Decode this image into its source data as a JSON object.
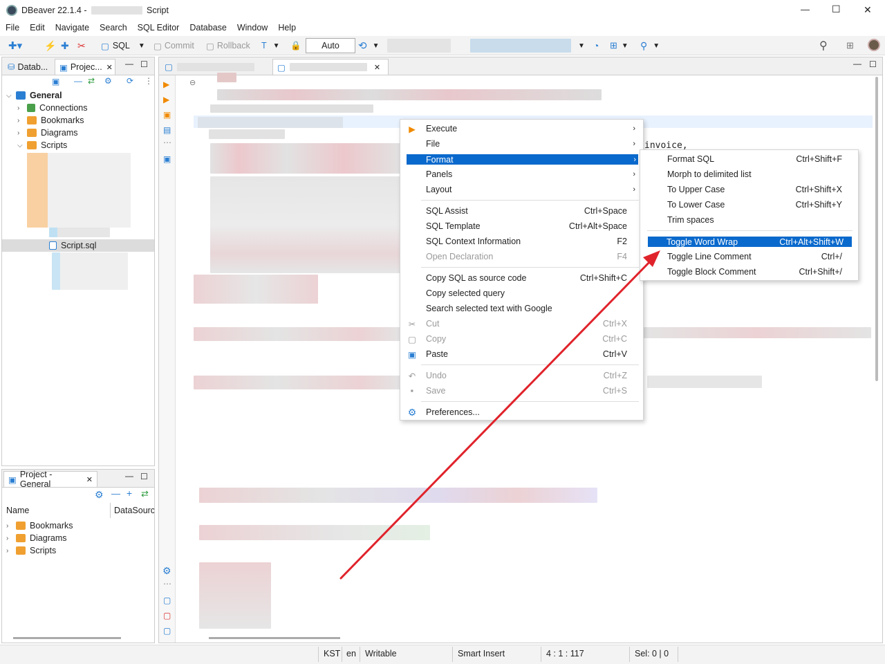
{
  "window": {
    "app_title": "DBeaver 22.1.4 -",
    "title_suffix": "Script",
    "minimize": "—",
    "maximize": "☐",
    "close": "✕"
  },
  "menubar": [
    "File",
    "Edit",
    "Navigate",
    "Search",
    "SQL Editor",
    "Database",
    "Window",
    "Help"
  ],
  "toolbar": {
    "sql_label": "SQL",
    "commit_label": "Commit",
    "rollback_label": "Rollback",
    "tx_mode": "Auto"
  },
  "left_panel": {
    "tabs": [
      "Datab...",
      "Projec..."
    ],
    "root": "General",
    "nodes": [
      "Connections",
      "Bookmarks",
      "Diagrams",
      "Scripts"
    ],
    "selected_file": "Script.sql"
  },
  "project_panel": {
    "title": "Project - General",
    "columns": [
      "Name",
      "DataSource"
    ],
    "nodes": [
      "Bookmarks",
      "Diagrams",
      "Scripts"
    ]
  },
  "editor": {
    "visible_text": "invoice,"
  },
  "context_menu": {
    "items": [
      {
        "label": "Execute",
        "shortcut": "",
        "submenu": true,
        "disabled": false
      },
      {
        "label": "File",
        "shortcut": "",
        "submenu": true,
        "disabled": false
      },
      {
        "label": "Format",
        "shortcut": "",
        "submenu": true,
        "disabled": false
      },
      {
        "label": "Panels",
        "shortcut": "",
        "submenu": true,
        "disabled": false
      },
      {
        "label": "Layout",
        "shortcut": "",
        "submenu": true,
        "disabled": false
      },
      {
        "label": "SQL Assist",
        "shortcut": "Ctrl+Space",
        "submenu": false,
        "disabled": false
      },
      {
        "label": "SQL Template",
        "shortcut": "Ctrl+Alt+Space",
        "submenu": false,
        "disabled": false
      },
      {
        "label": "SQL Context Information",
        "shortcut": "F2",
        "submenu": false,
        "disabled": false
      },
      {
        "label": "Open Declaration",
        "shortcut": "F4",
        "submenu": false,
        "disabled": true
      },
      {
        "label": "Copy SQL as source code",
        "shortcut": "Ctrl+Shift+C",
        "submenu": false,
        "disabled": false
      },
      {
        "label": "Copy selected query",
        "shortcut": "",
        "submenu": false,
        "disabled": false
      },
      {
        "label": "Search selected text with Google",
        "shortcut": "",
        "submenu": false,
        "disabled": false
      },
      {
        "label": "Cut",
        "shortcut": "Ctrl+X",
        "submenu": false,
        "disabled": true
      },
      {
        "label": "Copy",
        "shortcut": "Ctrl+C",
        "submenu": false,
        "disabled": true
      },
      {
        "label": "Paste",
        "shortcut": "Ctrl+V",
        "submenu": false,
        "disabled": false
      },
      {
        "label": "Undo",
        "shortcut": "Ctrl+Z",
        "submenu": false,
        "disabled": true
      },
      {
        "label": "Save",
        "shortcut": "Ctrl+S",
        "submenu": false,
        "disabled": true
      },
      {
        "label": "Preferences...",
        "shortcut": "",
        "submenu": false,
        "disabled": false
      }
    ]
  },
  "format_submenu": {
    "items": [
      {
        "label": "Format SQL",
        "shortcut": "Ctrl+Shift+F"
      },
      {
        "label": "Morph to delimited list",
        "shortcut": ""
      },
      {
        "label": "To Upper Case",
        "shortcut": "Ctrl+Shift+X"
      },
      {
        "label": "To Lower Case",
        "shortcut": "Ctrl+Shift+Y"
      },
      {
        "label": "Trim spaces",
        "shortcut": ""
      },
      {
        "label": "Toggle Word Wrap",
        "shortcut": "Ctrl+Alt+Shift+W"
      },
      {
        "label": "Toggle Line Comment",
        "shortcut": "Ctrl+/"
      },
      {
        "label": "Toggle Block Comment",
        "shortcut": "Ctrl+Shift+/"
      }
    ]
  },
  "status_bar": {
    "timezone": "KST",
    "locale": "en",
    "mode": "Writable",
    "insert_mode": "Smart Insert",
    "position": "4 : 1 : 117",
    "selection": "Sel: 0 | 0"
  },
  "colors": {
    "highlight": "#0a69cc",
    "arrow": "#e0232b"
  }
}
